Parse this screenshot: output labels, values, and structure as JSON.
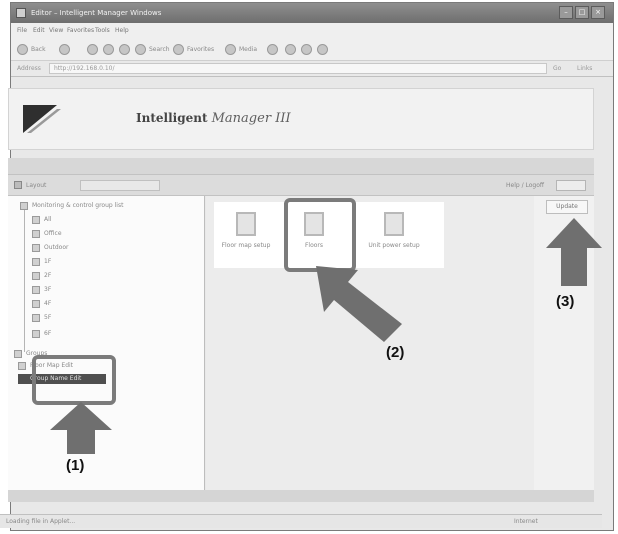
{
  "window": {
    "title": "Editor – Intelligent Manager Windows"
  },
  "menu": [
    "File",
    "Edit",
    "View",
    "Favorites",
    "Tools",
    "Help"
  ],
  "toolbar": {
    "back": "Back",
    "search": "Search",
    "favorites": "Favorites",
    "media": "Media"
  },
  "address": {
    "label": "Address",
    "value": "http://192.168.0.10/",
    "go": "Go",
    "links": "Links"
  },
  "banner": {
    "title_plain": "Intelligent",
    "title_styled": "Manager",
    "title_suffix": "III"
  },
  "section_bar": {
    "left": "Layout",
    "right": "Help / Logoff"
  },
  "tree": {
    "root": "Monitoring & control group list",
    "items": [
      "All",
      "Office",
      "Outdoor",
      "1F",
      "2F",
      "3F",
      "4F",
      "5F",
      "6F"
    ],
    "groups_label": "Groups",
    "group_items": [
      "Floor Map Edit",
      "Group Name Edit"
    ]
  },
  "content": {
    "icons": [
      {
        "label": "Floor map setup"
      },
      {
        "label": "Floors"
      },
      {
        "label": "Unit power setup"
      }
    ],
    "update_button": "Update"
  },
  "callouts": {
    "one": "(1)",
    "two": "(2)",
    "three": "(3)"
  },
  "status": {
    "left": "Loading file in Applet...",
    "right": "Internet"
  },
  "colors": {
    "highlight": "#7b7b7b",
    "arrow": "#6f6f6f",
    "titlebar": "#7d7d7d"
  }
}
